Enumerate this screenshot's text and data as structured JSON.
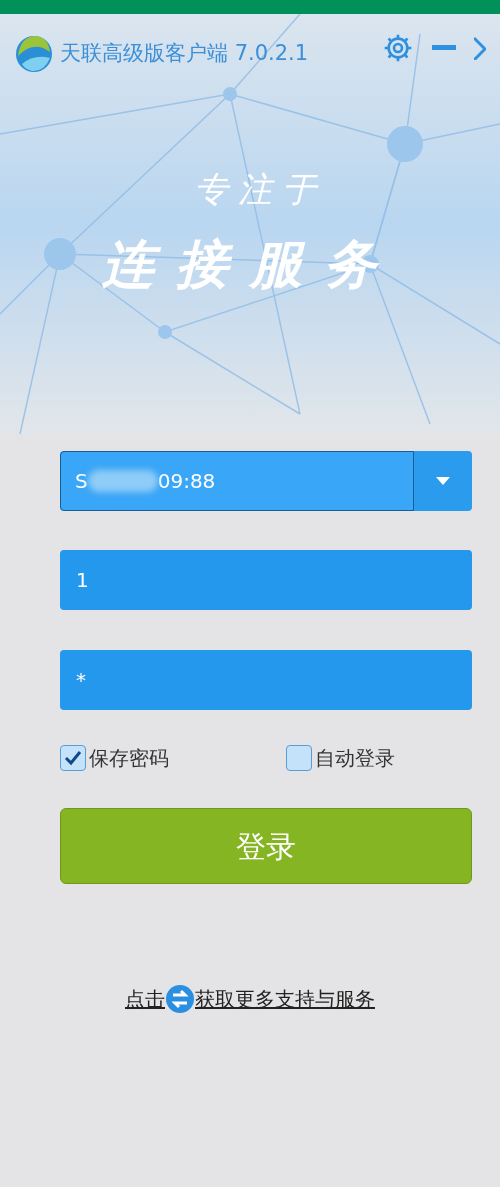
{
  "window": {
    "title": "天联高级版客户端 7.0.2.1"
  },
  "slogan": {
    "line_1": "专注于",
    "line_2": "连接服务"
  },
  "server_field": {
    "value_start": "S",
    "value_end": "09:88",
    "redacted": true
  },
  "username_field": {
    "value": "1"
  },
  "password_field": {
    "value": "*"
  },
  "options": [
    {
      "label": "保存密码",
      "checked": true
    },
    {
      "label": "自动登录",
      "checked": false
    }
  ],
  "login_button": {
    "label": "登录"
  },
  "support_link": {
    "text_before": "点击",
    "text_after": "获取更多支持与服务"
  }
}
